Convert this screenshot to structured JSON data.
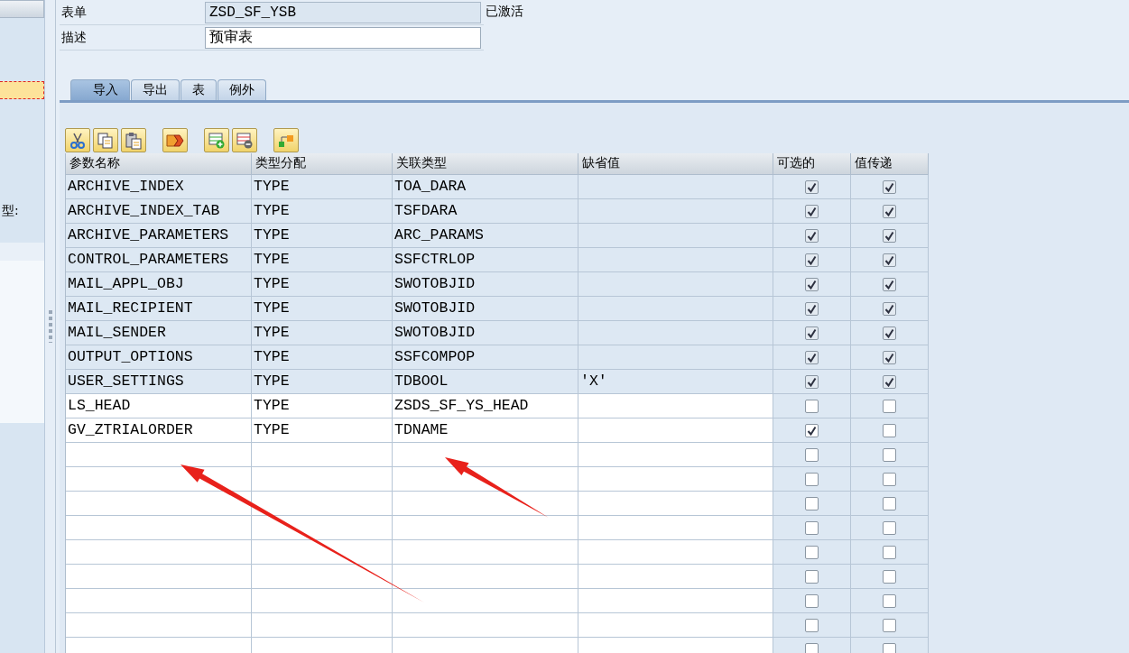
{
  "sidebar": {
    "items": [
      {
        "selected": false
      },
      {
        "selected": true
      }
    ],
    "label": "型:"
  },
  "form": [
    {
      "label": "表单",
      "value": "ZSD_SF_YSB",
      "readonly": true,
      "status": "已激活"
    },
    {
      "label": "描述",
      "value": "预审表",
      "readonly": false
    }
  ],
  "tabs": [
    {
      "label": "导入",
      "selected": true
    },
    {
      "label": "导出",
      "selected": false
    },
    {
      "label": "表",
      "selected": false
    },
    {
      "label": "例外",
      "selected": false
    }
  ],
  "toolbar_groups": [
    {
      "buttons": [
        {
          "kind": "cut"
        },
        {
          "kind": "copy"
        },
        {
          "kind": "paste"
        }
      ]
    },
    {
      "buttons": [
        {
          "kind": "convert"
        }
      ]
    },
    {
      "buttons": [
        {
          "kind": "insert-row"
        },
        {
          "kind": "delete-row"
        }
      ]
    },
    {
      "buttons": [
        {
          "kind": "hierarchy"
        }
      ]
    }
  ],
  "table": {
    "columns": [
      "参数名称",
      "类型分配",
      "关联类型",
      "缺省值",
      "可选的",
      "值传递"
    ],
    "rows": [
      {
        "name": "ARCHIVE_INDEX",
        "typing": "TYPE",
        "ref_type": "TOA_DARA",
        "optional": true,
        "by_value": true,
        "readonly": true
      },
      {
        "name": "ARCHIVE_INDEX_TAB",
        "typing": "TYPE",
        "ref_type": "TSFDARA",
        "optional": true,
        "by_value": true,
        "readonly": true
      },
      {
        "name": "ARCHIVE_PARAMETERS",
        "typing": "TYPE",
        "ref_type": "ARC_PARAMS",
        "optional": true,
        "by_value": true,
        "readonly": true
      },
      {
        "name": "CONTROL_PARAMETERS",
        "typing": "TYPE",
        "ref_type": "SSFCTRLOP",
        "optional": true,
        "by_value": true,
        "readonly": true
      },
      {
        "name": "MAIL_APPL_OBJ",
        "typing": "TYPE",
        "ref_type": "SWOTOBJID",
        "optional": true,
        "by_value": true,
        "readonly": true
      },
      {
        "name": "MAIL_RECIPIENT",
        "typing": "TYPE",
        "ref_type": "SWOTOBJID",
        "optional": true,
        "by_value": true,
        "readonly": true
      },
      {
        "name": "MAIL_SENDER",
        "typing": "TYPE",
        "ref_type": "SWOTOBJID",
        "optional": true,
        "by_value": true,
        "readonly": true
      },
      {
        "name": "OUTPUT_OPTIONS",
        "typing": "TYPE",
        "ref_type": "SSFCOMPOP",
        "optional": true,
        "by_value": true,
        "readonly": true
      },
      {
        "name": "USER_SETTINGS",
        "typing": "TYPE",
        "ref_type": "TDBOOL",
        "default": "'X'",
        "optional": true,
        "by_value": true,
        "readonly": true
      },
      {
        "name": "LS_HEAD",
        "typing": "TYPE",
        "ref_type": "ZSDS_SF_YS_HEAD",
        "optional": false,
        "by_value": false,
        "readonly": false
      },
      {
        "name": "GV_ZTRIALORDER",
        "typing": "TYPE",
        "ref_type": "TDNAME",
        "optional": true,
        "by_value": false,
        "readonly": false
      },
      {
        "optional": false,
        "by_value": false,
        "readonly": false
      },
      {
        "optional": false,
        "by_value": false,
        "readonly": false
      },
      {
        "optional": false,
        "by_value": false,
        "readonly": false
      },
      {
        "optional": false,
        "by_value": false,
        "readonly": false
      },
      {
        "optional": false,
        "by_value": false,
        "readonly": false
      },
      {
        "optional": false,
        "by_value": false,
        "readonly": false
      },
      {
        "optional": false,
        "by_value": false,
        "readonly": false
      },
      {
        "optional": false,
        "by_value": false,
        "readonly": false
      },
      {
        "optional": false,
        "by_value": false,
        "readonly": false
      }
    ]
  },
  "annotations": [
    {
      "kind": "arrow"
    },
    {
      "kind": "arrow"
    }
  ]
}
